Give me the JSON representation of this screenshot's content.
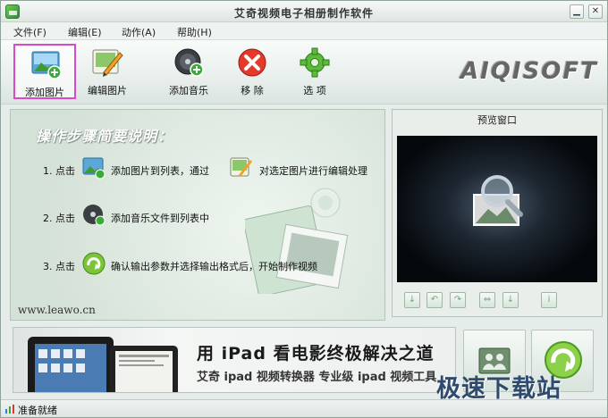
{
  "window": {
    "title": "艾奇视频电子相册制作软件"
  },
  "menu": [
    {
      "label": "文件(F)"
    },
    {
      "label": "编辑(E)"
    },
    {
      "label": "动作(A)"
    },
    {
      "label": "帮助(H)"
    }
  ],
  "toolbar": {
    "buttons": [
      {
        "label": "添加图片",
        "icon": "add-image-icon",
        "selected": true
      },
      {
        "label": "编辑图片",
        "icon": "edit-image-icon"
      },
      {
        "label": "添加音乐",
        "icon": "add-music-icon"
      },
      {
        "label": "移 除",
        "icon": "remove-icon"
      },
      {
        "label": "选 项",
        "icon": "options-gear-icon"
      }
    ],
    "logo": "AIQISOFT"
  },
  "instructions": {
    "title": "操作步骤简要说明：",
    "step1": {
      "prefix": "1. 点击",
      "text_a": "添加图片到列表，通过",
      "text_b": "对选定图片进行编辑处理"
    },
    "step2": {
      "prefix": "2. 点击",
      "text": "添加音乐文件到列表中"
    },
    "step3": {
      "prefix": "3. 点击",
      "text": "确认输出参数并选择输出格式后，开始制作视频"
    },
    "website": "www.leawo.cn"
  },
  "preview": {
    "title": "预览窗口"
  },
  "banner": {
    "headline": "用 iPad 看电影终极解决之道",
    "subline": "艾奇 ipad 视频转换器  专业级 ipad 视频工具"
  },
  "watermark": "极速下载站",
  "status": {
    "text": "准备就绪"
  },
  "colors": {
    "selected_border": "#d84ac9",
    "accent_green": "#3a9a3a"
  }
}
